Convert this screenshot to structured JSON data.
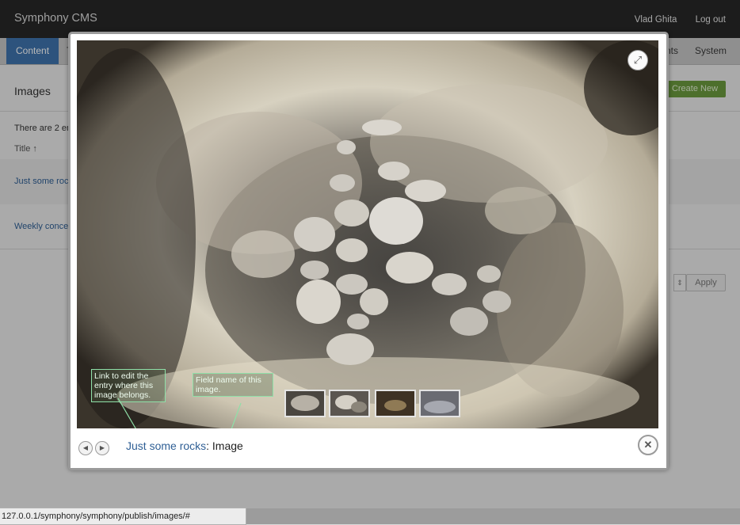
{
  "header": {
    "app_title": "Symphony CMS",
    "user_name": "Vlad Ghita",
    "logout_label": "Log out"
  },
  "tabs": [
    {
      "label": "Content",
      "active": true
    },
    {
      "label": "T"
    },
    {
      "label": "nts"
    },
    {
      "label": "System"
    }
  ],
  "page": {
    "title": "Images",
    "create_button": "Create New",
    "count_text": "There are 2 en",
    "column_header": "Title ↑",
    "rows": [
      {
        "title": "Just some rock"
      },
      {
        "title": "Weekly concer"
      }
    ],
    "apply_label": "Apply"
  },
  "lightbox": {
    "caption_link": "Just some rocks",
    "caption_rest": ": Image",
    "annotations": [
      "Link to edit the entry where this image belongs.",
      "Field name of this image."
    ],
    "thumbnail_count": 4
  },
  "status_url": "127.0.0.1/symphony/symphony/publish/images/#",
  "colors": {
    "header_bg": "#272727",
    "tab_active": "#3f73ad",
    "link": "#2f5f95",
    "create_button": "#6b9a3e",
    "annotation_border": "#8fe0a8"
  },
  "icons": [
    "expand-icon",
    "prev-icon",
    "next-icon",
    "close-icon"
  ]
}
